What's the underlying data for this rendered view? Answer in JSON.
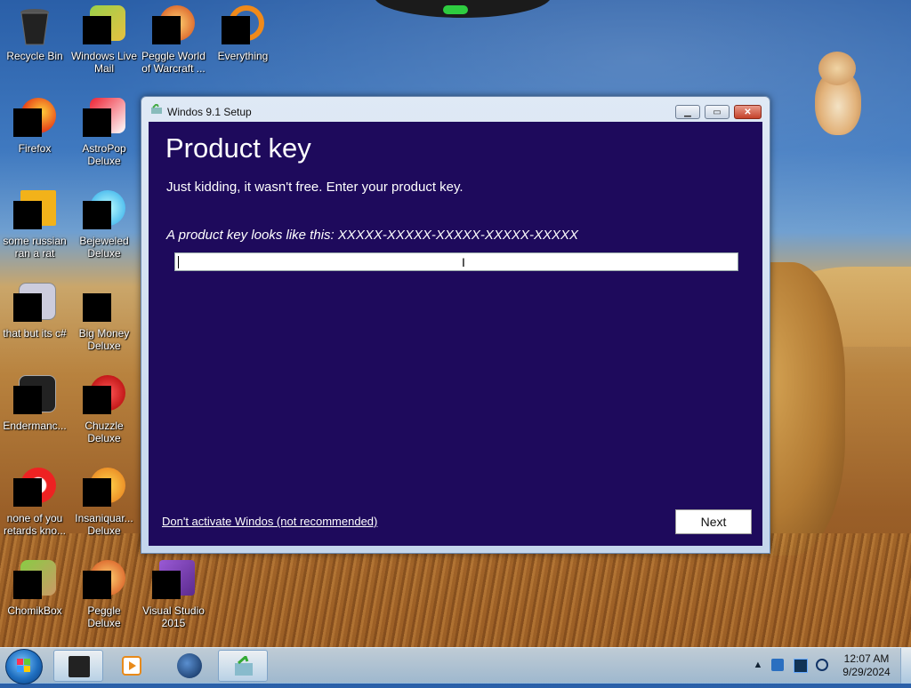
{
  "desktop": {
    "icons": [
      {
        "label": "Recycle Bin",
        "icon": "recycle-bin-icon"
      },
      {
        "label": "Windows Live Mail",
        "icon": "mail-icon"
      },
      {
        "label": "Peggle World of Warcraft ...",
        "icon": "peggle-wow-icon"
      },
      {
        "label": "Everything",
        "icon": "everything-search-icon"
      },
      {
        "label": "Firefox",
        "icon": "firefox-icon"
      },
      {
        "label": "AstroPop Deluxe",
        "icon": "astropop-icon"
      },
      {
        "label": "some russian ran a rat",
        "icon": "document-icon"
      },
      {
        "label": "Bejeweled Deluxe",
        "icon": "bejeweled-icon"
      },
      {
        "label": "that but its c#",
        "icon": "shortcut-icon"
      },
      {
        "label": "Big Money Deluxe",
        "icon": "big-money-icon"
      },
      {
        "label": "Endermanc...",
        "icon": "app-icon"
      },
      {
        "label": "Chuzzle Deluxe",
        "icon": "chuzzle-icon"
      },
      {
        "label": "none of you retards kno...",
        "icon": "app-icon"
      },
      {
        "label": "Insaniquar... Deluxe",
        "icon": "insaniquarium-icon"
      },
      {
        "label": "ChomikBox",
        "icon": "chomikbox-icon"
      },
      {
        "label": "Peggle Deluxe",
        "icon": "peggle-icon"
      },
      {
        "label": "Visual Studio 2015",
        "icon": "visual-studio-icon"
      }
    ]
  },
  "window": {
    "title": "Windos 9.1 Setup",
    "buttons": {
      "minimize": "▁",
      "maximize": "▭",
      "close": "✕"
    },
    "heading": "Product key",
    "subtext": "Just kidding, it wasn't free. Enter your product key.",
    "hint": "A product key looks like this: XXXXX-XXXXX-XXXXX-XXXXX-XXXXX",
    "key_value": "",
    "skip_link": "Don't activate Windos (not recommended)",
    "next_label": "Next",
    "colors": {
      "client_bg": "#1e0a5c",
      "text": "#ffffff"
    }
  },
  "taskbar": {
    "pinned": [
      "start-orb-icon",
      "terminal-icon",
      "media-player-icon",
      "globe-icon",
      "setup-icon"
    ],
    "tray": {
      "chevron": "▲",
      "time": "12:07 AM",
      "date": "9/29/2024"
    }
  }
}
